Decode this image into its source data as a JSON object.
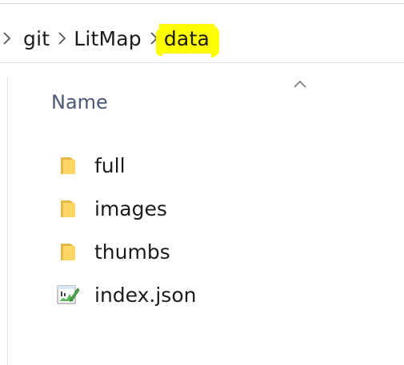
{
  "breadcrumb": {
    "items": [
      "git",
      "LitMap",
      "data"
    ],
    "highlighted_index": 2,
    "highlight_color": "#ffff00"
  },
  "column_header": {
    "name_label": "Name",
    "sort_icon": "chevron-up-icon"
  },
  "files": [
    {
      "name": "full",
      "icon": "folder-icon",
      "color": "#f5c84c"
    },
    {
      "name": "images",
      "icon": "folder-icon",
      "color": "#f5c84c"
    },
    {
      "name": "thumbs",
      "icon": "folder-icon",
      "color": "#f5c84c"
    },
    {
      "name": "index.json",
      "icon": "json-file-icon",
      "color": "#4caf50"
    }
  ]
}
